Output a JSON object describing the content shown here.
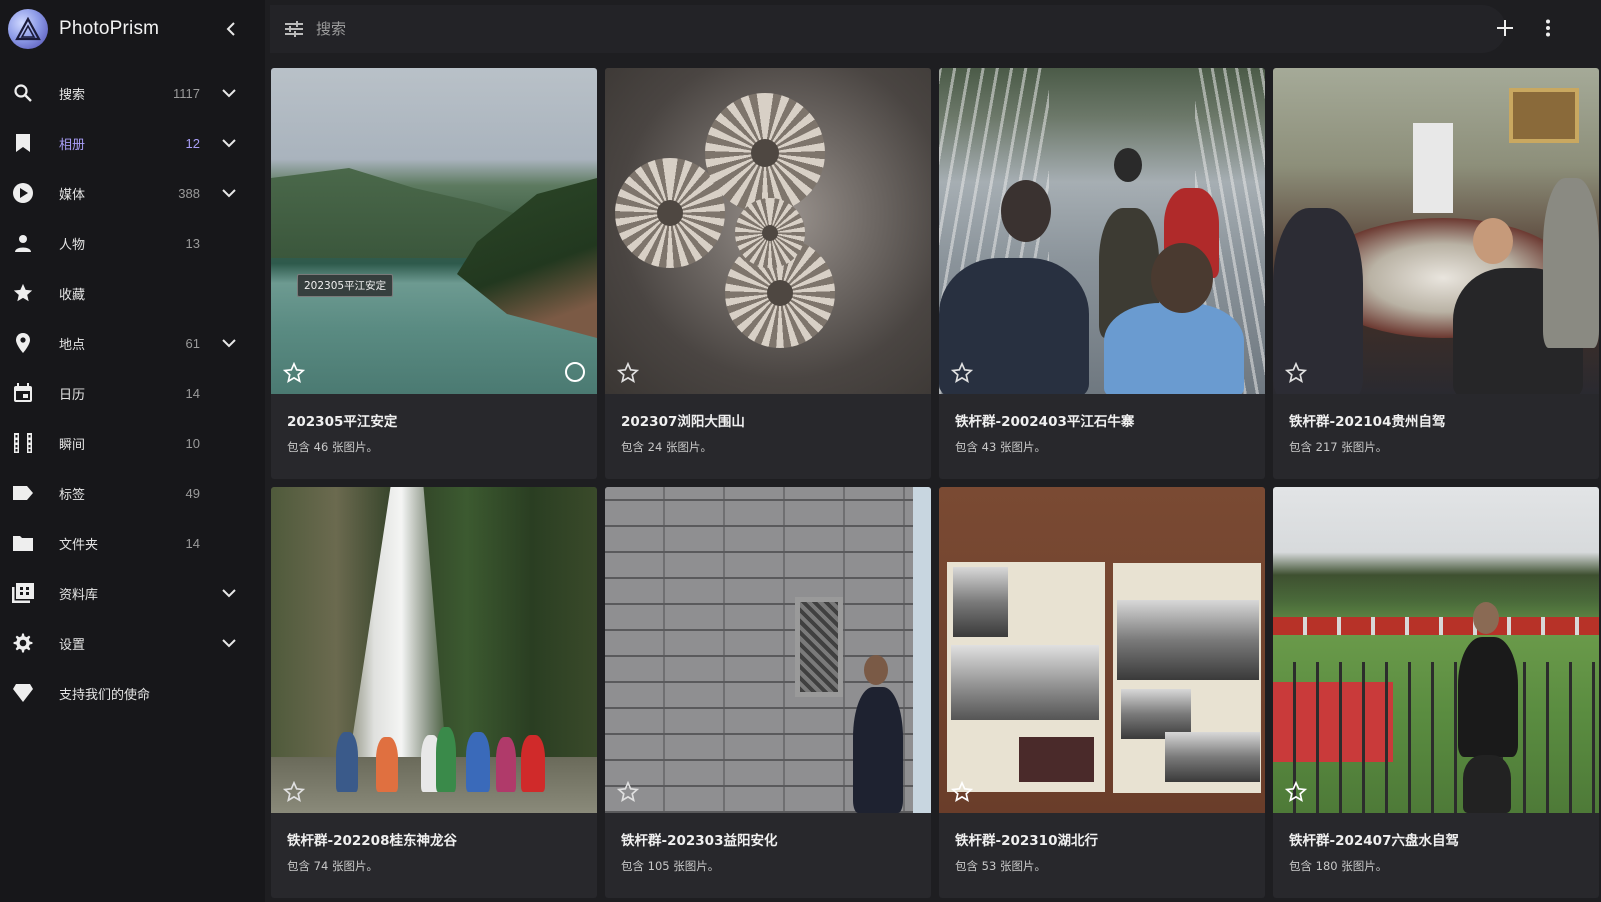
{
  "app": {
    "name": "PhotoPrism"
  },
  "search": {
    "placeholder": "搜索"
  },
  "sidebar": {
    "items": [
      {
        "label": "搜索",
        "count": "1117",
        "expandable": true,
        "icon": "search-icon",
        "active": false
      },
      {
        "label": "相册",
        "count": "12",
        "expandable": true,
        "icon": "bookmark-icon",
        "active": true
      },
      {
        "label": "媒体",
        "count": "388",
        "expandable": true,
        "icon": "play-circle-icon",
        "active": false
      },
      {
        "label": "人物",
        "count": "13",
        "expandable": false,
        "icon": "person-icon",
        "active": false
      },
      {
        "label": "收藏",
        "count": "",
        "expandable": false,
        "icon": "star-icon",
        "active": false
      },
      {
        "label": "地点",
        "count": "61",
        "expandable": true,
        "icon": "place-icon",
        "active": false
      },
      {
        "label": "日历",
        "count": "14",
        "expandable": false,
        "icon": "calendar-icon",
        "active": false
      },
      {
        "label": "瞬间",
        "count": "10",
        "expandable": false,
        "icon": "film-icon",
        "active": false
      },
      {
        "label": "标签",
        "count": "49",
        "expandable": false,
        "icon": "label-icon",
        "active": false
      },
      {
        "label": "文件夹",
        "count": "14",
        "expandable": false,
        "icon": "folder-icon",
        "active": false
      },
      {
        "label": "资料库",
        "count": "",
        "expandable": true,
        "icon": "library-icon",
        "active": false
      },
      {
        "label": "设置",
        "count": "",
        "expandable": true,
        "icon": "gear-icon",
        "active": false
      },
      {
        "label": "支持我们的使命",
        "count": "",
        "expandable": false,
        "icon": "diamond-icon",
        "active": false
      }
    ]
  },
  "albums": [
    {
      "title": "202305平江安定",
      "subtitle": "包含 46 张图片。",
      "tooltip": "202305平江安定"
    },
    {
      "title": "202307浏阳大围山",
      "subtitle": "包含 24 张图片。"
    },
    {
      "title": "铁杆群-2002403平江石牛寨",
      "subtitle": "包含 43 张图片。"
    },
    {
      "title": "铁杆群-202104贵州自驾",
      "subtitle": "包含 217 张图片。"
    },
    {
      "title": "铁杆群-202208桂东神龙谷",
      "subtitle": "包含 74 张图片。"
    },
    {
      "title": "铁杆群-202303益阳安化",
      "subtitle": "包含 105 张图片。"
    },
    {
      "title": "铁杆群-202310湖北行",
      "subtitle": "包含 53 张图片。"
    },
    {
      "title": "铁杆群-202407六盘水自驾",
      "subtitle": "包含 180 张图片。"
    }
  ],
  "colors": {
    "accent": "#a89ef7",
    "sidebar_bg": "#17171a",
    "page_bg": "#1e1e21",
    "card_bg": "#28282c"
  }
}
